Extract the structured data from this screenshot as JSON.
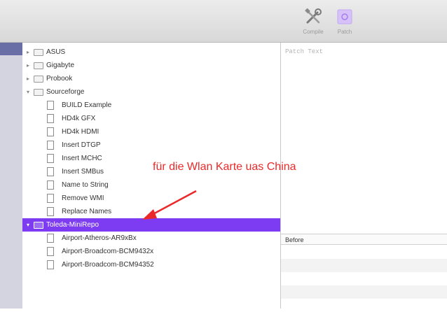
{
  "toolbar": {
    "compile_label": "Compile",
    "patch_label": "Patch"
  },
  "tree": {
    "items": [
      {
        "label": "ASUS",
        "type": "folder",
        "expanded": false
      },
      {
        "label": "Gigabyte",
        "type": "folder",
        "expanded": false
      },
      {
        "label": "Probook",
        "type": "folder",
        "expanded": false
      },
      {
        "label": "Sourceforge",
        "type": "folder",
        "expanded": true
      },
      {
        "label": "BUILD Example",
        "type": "file"
      },
      {
        "label": "HD4k GFX",
        "type": "file"
      },
      {
        "label": "HD4k HDMI",
        "type": "file"
      },
      {
        "label": "Insert DTGP",
        "type": "file"
      },
      {
        "label": "Insert MCHC",
        "type": "file"
      },
      {
        "label": "Insert SMBus",
        "type": "file"
      },
      {
        "label": "Name to String",
        "type": "file"
      },
      {
        "label": "Remove WMI",
        "type": "file"
      },
      {
        "label": "Replace Names",
        "type": "file"
      },
      {
        "label": "Toleda-MiniRepo",
        "type": "folder",
        "expanded": true,
        "selected": true
      },
      {
        "label": "Airport-Atheros-AR9xBx",
        "type": "file"
      },
      {
        "label": "Airport-Broadcom-BCM9432x",
        "type": "file"
      },
      {
        "label": "Airport-Broadcom-BCM94352",
        "type": "file"
      }
    ]
  },
  "annotation": {
    "text": "für die Wlan Karte uas China",
    "color": "#ea2a2a"
  },
  "patch_panel": {
    "placeholder": "Patch Text",
    "before_label": "Before"
  },
  "colors": {
    "selection": "#7d3cf2",
    "accent_icon": "#c9a9f7"
  }
}
